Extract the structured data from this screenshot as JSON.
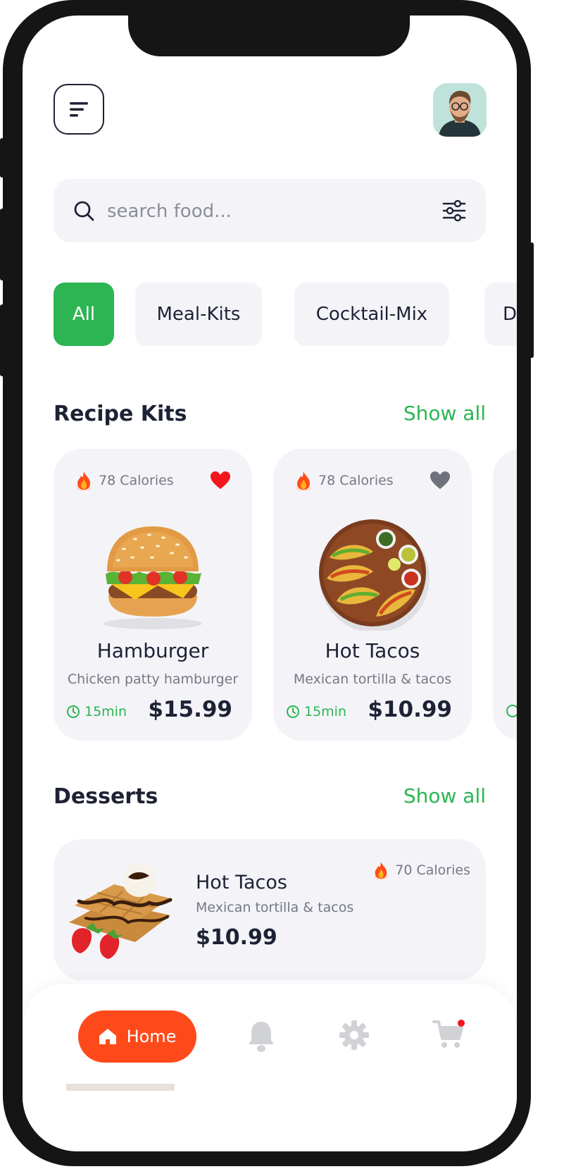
{
  "header": {
    "menu_icon": "menu-icon",
    "avatar_icon": "avatar"
  },
  "search": {
    "placeholder": "search food...",
    "icon": "search-icon",
    "filter_icon": "sliders-icon"
  },
  "categories": [
    {
      "label": "All",
      "active": true
    },
    {
      "label": "Meal-Kits",
      "active": false
    },
    {
      "label": "Cocktail-Mix",
      "active": false
    },
    {
      "label": "De",
      "active": false
    }
  ],
  "recipe_kits": {
    "title": "Recipe Kits",
    "show_all": "Show all",
    "items": [
      {
        "calories": "78 Calories",
        "name": "Hamburger",
        "desc": "Chicken patty hamburger",
        "time": "15min",
        "price": "$15.99",
        "favorite": true
      },
      {
        "calories": "78 Calories",
        "name": "Hot Tacos",
        "desc": "Mexican tortilla & tacos",
        "time": "15min",
        "price": "$10.99",
        "favorite": false
      }
    ]
  },
  "desserts": {
    "title": "Desserts",
    "show_all": "Show all",
    "items": [
      {
        "name": "Hot Tacos",
        "desc": "Mexican tortilla & tacos",
        "price": "$10.99",
        "calories": "70 Calories"
      }
    ]
  },
  "bottom_nav": {
    "home_label": "Home",
    "items": [
      "home-icon",
      "bell-icon",
      "gear-icon",
      "cart-icon"
    ]
  },
  "colors": {
    "accent_green": "#2cb552",
    "accent_orange": "#fe4a1a",
    "heart_red": "#f3161c",
    "text_dark": "#1d2235",
    "text_muted": "#747884",
    "card_bg": "#f4f4f8"
  }
}
